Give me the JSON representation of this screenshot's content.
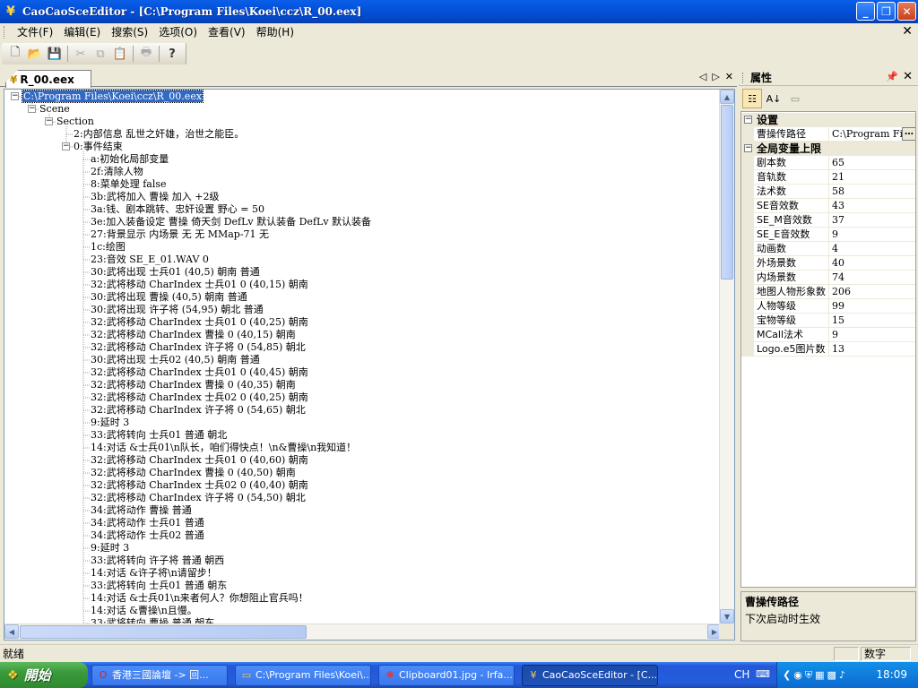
{
  "window": {
    "title": "CaoCaoSceEditor - [C:\\Program Files\\Koei\\ccz\\R_00.eex]"
  },
  "menu": [
    {
      "label": "文件(F)"
    },
    {
      "label": "编辑(E)"
    },
    {
      "label": "搜索(S)"
    },
    {
      "label": "选项(O)"
    },
    {
      "label": "查看(V)"
    },
    {
      "label": "帮助(H)"
    }
  ],
  "document_tab": {
    "label": "R_00.eex"
  },
  "tree": [
    {
      "text": "C:\\Program Files\\Koei\\ccz\\R_00.eex",
      "level": 0,
      "expandable": true,
      "selected": true
    },
    {
      "text": "Scene",
      "level": 1,
      "expandable": true
    },
    {
      "text": "Section",
      "level": 2,
      "expandable": true
    },
    {
      "text": "2:内部信息 乱世之奸雄，治世之能臣。",
      "level": 3
    },
    {
      "text": "0:事件结束",
      "level": 3,
      "expandable": true
    },
    {
      "text": "a:初始化局部变量",
      "level": 4
    },
    {
      "text": "2f:清除人物",
      "level": 4
    },
    {
      "text": "8:菜单处理 false",
      "level": 4
    },
    {
      "text": "3b:武将加入 曹操 加入 +2级",
      "level": 4
    },
    {
      "text": "3a:钱、剧本跳转、忠奸设置 野心 = 50",
      "level": 4
    },
    {
      "text": "3e:加入装备设定 曹操 倚天剑 DefLv 默认装备 DefLv 默认装备",
      "level": 4
    },
    {
      "text": "27:背景显示 内场景 无 无 MMap-71 无",
      "level": 4
    },
    {
      "text": "1c:绘图",
      "level": 4
    },
    {
      "text": "23:音效 SE_E_01.WAV 0",
      "level": 4
    },
    {
      "text": "30:武将出现 士兵01 (40,5) 朝南 普通",
      "level": 4
    },
    {
      "text": "32:武将移动 CharIndex 士兵01 0 (40,15) 朝南",
      "level": 4
    },
    {
      "text": "30:武将出现 曹操 (40,5) 朝南 普通",
      "level": 4
    },
    {
      "text": "30:武将出现 许子将 (54,95) 朝北 普通",
      "level": 4
    },
    {
      "text": "32:武将移动 CharIndex 士兵01 0 (40,25) 朝南",
      "level": 4
    },
    {
      "text": "32:武将移动 CharIndex 曹操 0 (40,15) 朝南",
      "level": 4
    },
    {
      "text": "32:武将移动 CharIndex 许子将 0 (54,85) 朝北",
      "level": 4
    },
    {
      "text": "30:武将出现 士兵02 (40,5) 朝南 普通",
      "level": 4
    },
    {
      "text": "32:武将移动 CharIndex 士兵01 0 (40,45) 朝南",
      "level": 4
    },
    {
      "text": "32:武将移动 CharIndex 曹操 0 (40,35) 朝南",
      "level": 4
    },
    {
      "text": "32:武将移动 CharIndex 士兵02 0 (40,25) 朝南",
      "level": 4
    },
    {
      "text": "32:武将移动 CharIndex 许子将 0 (54,65) 朝北",
      "level": 4
    },
    {
      "text": "9:延时 3",
      "level": 4
    },
    {
      "text": "33:武将转向 士兵01 普通 朝北",
      "level": 4
    },
    {
      "text": "14:对话 &士兵01\\n队长，咱们得快点！\\n&曹操\\n我知道！",
      "level": 4
    },
    {
      "text": "32:武将移动 CharIndex 士兵01 0 (40,60) 朝南",
      "level": 4
    },
    {
      "text": "32:武将移动 CharIndex 曹操 0 (40,50) 朝南",
      "level": 4
    },
    {
      "text": "32:武将移动 CharIndex 士兵02 0 (40,40) 朝南",
      "level": 4
    },
    {
      "text": "32:武将移动 CharIndex 许子将 0 (54,50) 朝北",
      "level": 4
    },
    {
      "text": "34:武将动作 曹操 普通",
      "level": 4
    },
    {
      "text": "34:武将动作 士兵01 普通",
      "level": 4
    },
    {
      "text": "34:武将动作 士兵02 普通",
      "level": 4
    },
    {
      "text": "9:延时 3",
      "level": 4
    },
    {
      "text": "33:武将转向 许子将 普通 朝西",
      "level": 4
    },
    {
      "text": "14:对话 &许子将\\n请留步！",
      "level": 4
    },
    {
      "text": "33:武将转向 士兵01 普通 朝东",
      "level": 4
    },
    {
      "text": "14:对话 &士兵01\\n来者何人？你想阻止官兵吗！",
      "level": 4
    },
    {
      "text": "14:对话 &曹操\\n且慢。",
      "level": 4
    },
    {
      "text": "33:武将转向 曹操 普通 朝东",
      "level": 4
    }
  ],
  "properties": {
    "title": "属性",
    "categories": [
      {
        "name": "设置",
        "items": [
          {
            "name": "曹操传路径",
            "value": "C:\\Program Files",
            "has_button": true
          }
        ]
      },
      {
        "name": "全局变量上限",
        "items": [
          {
            "name": "剧本数",
            "value": "65"
          },
          {
            "name": "音轨数",
            "value": "21"
          },
          {
            "name": "法术数",
            "value": "58"
          },
          {
            "name": "SE音效数",
            "value": "43"
          },
          {
            "name": "SE_M音效数",
            "value": "37"
          },
          {
            "name": "SE_E音效数",
            "value": "9"
          },
          {
            "name": "动画数",
            "value": "4"
          },
          {
            "name": "外场景数",
            "value": "40"
          },
          {
            "name": "内场景数",
            "value": "74"
          },
          {
            "name": "地图人物形象数",
            "value": "206"
          },
          {
            "name": "人物等级",
            "value": "99"
          },
          {
            "name": "宝物等级",
            "value": "15"
          },
          {
            "name": "MCall法术",
            "value": "9"
          },
          {
            "name": "Logo.e5图片数",
            "value": "13"
          }
        ]
      }
    ],
    "description": {
      "title": "曹操传路径",
      "text": "下次启动时生效"
    }
  },
  "status": {
    "message": "就绪",
    "num_indicator": "数字"
  },
  "taskbar": {
    "start_label": "開始",
    "tasks": [
      {
        "label": "香港三國論壇 -> 回...",
        "icon": "opera-icon"
      },
      {
        "label": "C:\\Program Files\\Koei\\...",
        "icon": "folder-icon"
      },
      {
        "label": "Clipboard01.jpg - Irfa...",
        "icon": "irfanview-icon"
      },
      {
        "label": "CaoCaoSceEditor - [C...",
        "icon": "app-icon",
        "active": true
      }
    ],
    "lang": "CH",
    "clock": "18:09"
  }
}
